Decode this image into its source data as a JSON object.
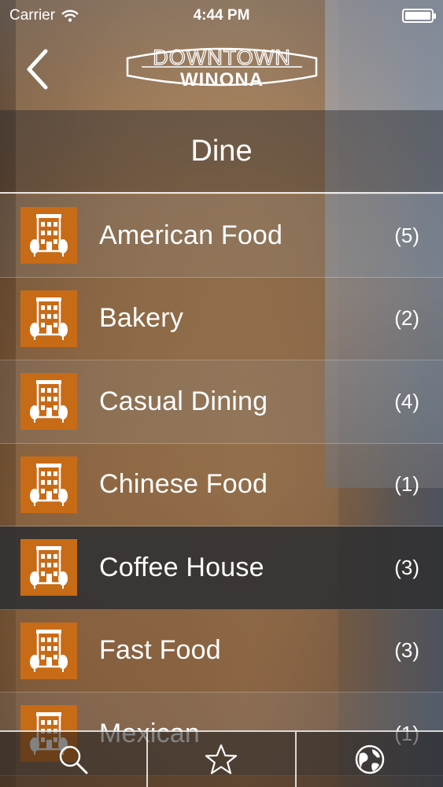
{
  "status_bar": {
    "carrier": "Carrier",
    "time": "4:44 PM"
  },
  "nav": {
    "logo_top": "DOWNTOWN",
    "logo_bottom": "WINONA"
  },
  "section": {
    "title": "Dine"
  },
  "categories": [
    {
      "label": "American Food",
      "count": "(5)"
    },
    {
      "label": "Bakery",
      "count": "(2)"
    },
    {
      "label": "Casual Dining",
      "count": "(4)"
    },
    {
      "label": "Chinese Food",
      "count": "(1)"
    },
    {
      "label": "Coffee House",
      "count": "(3)",
      "selected": true
    },
    {
      "label": "Fast Food",
      "count": "(3)"
    },
    {
      "label": "Mexican",
      "count": "(1)"
    }
  ],
  "tab_bar": {
    "tabs": [
      {
        "icon": "search-icon"
      },
      {
        "icon": "star-icon"
      },
      {
        "icon": "globe-icon"
      }
    ]
  },
  "colors": {
    "thumbnail_orange": "#c86b17",
    "selected_row": "#303032"
  }
}
